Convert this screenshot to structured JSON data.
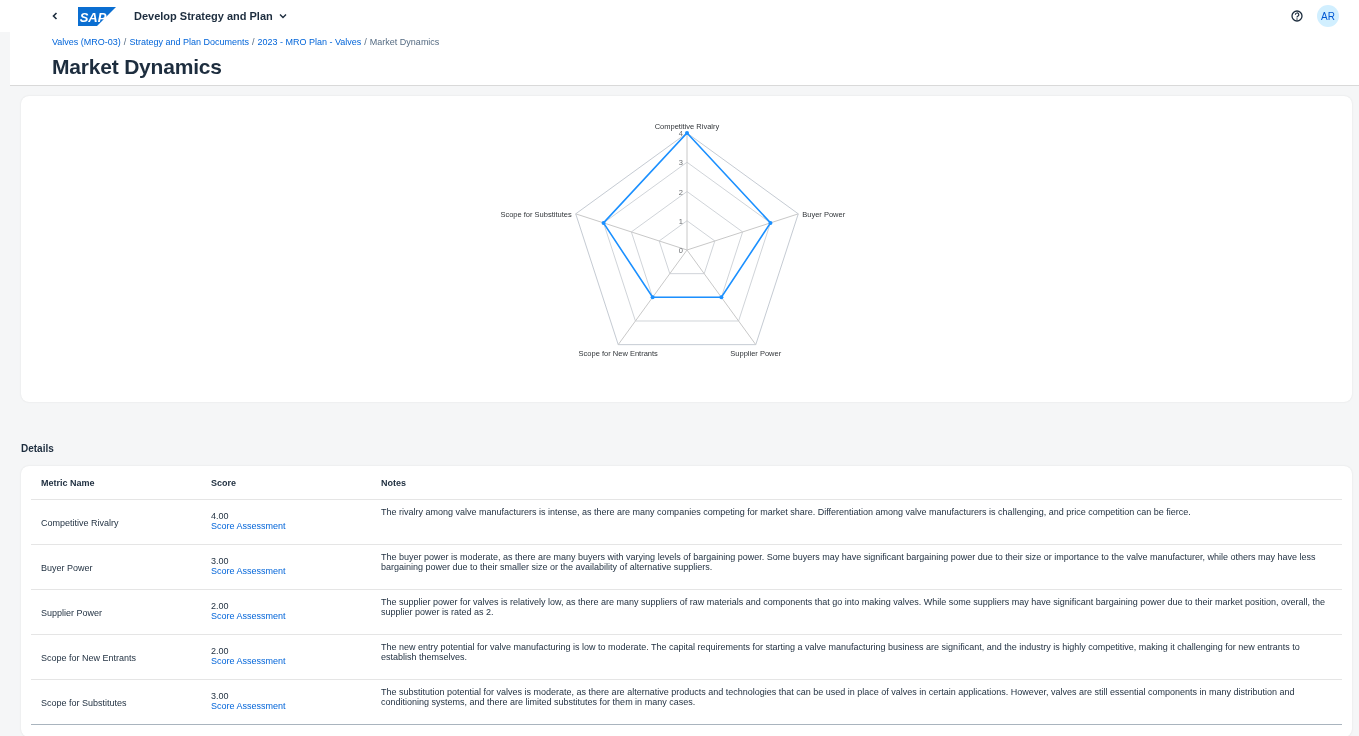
{
  "shell": {
    "logo": "SAP",
    "app_title": "Develop Strategy and Plan",
    "avatar": "AR"
  },
  "breadcrumbs": [
    {
      "label": "Valves (MRO-03)",
      "kind": "link"
    },
    {
      "label": "/",
      "kind": "separator"
    },
    {
      "label": "Strategy and Plan Documents",
      "kind": "link"
    },
    {
      "label": "/",
      "kind": "separator"
    },
    {
      "label": "2023 - MRO Plan - Valves",
      "kind": "link"
    },
    {
      "label": "/",
      "kind": "separator"
    },
    {
      "label": "Market Dynamics",
      "kind": "current"
    }
  ],
  "title": "Market Dynamics",
  "chart": {
    "chart_data": {
      "type": "radar",
      "categories": [
        "Competitive Rivalry",
        "Buyer Power",
        "Supplier Power",
        "Scope for New Entrants",
        "Scope for Substitutes"
      ],
      "values": [
        4,
        3,
        2,
        2,
        3
      ],
      "ylim": [
        0,
        4
      ],
      "yticks": [
        0,
        1,
        2,
        3,
        4
      ]
    }
  },
  "details": {
    "title": "Details",
    "columns": [
      "Metric Name",
      "Score",
      "Notes"
    ],
    "rows": [
      {
        "metric": "Competitive Rivalry",
        "score": "4.00",
        "link": "Score Assessment",
        "notes": "The rivalry among valve manufacturers is intense, as there are many companies competing for market share. Differentiation among valve manufacturers is challenging, and price competition can be fierce."
      },
      {
        "metric": "Buyer Power",
        "score": "3.00",
        "link": "Score Assessment",
        "notes": "The buyer power is moderate, as there are many buyers with varying levels of bargaining power. Some buyers may have significant bargaining power due to their size or importance to the valve manufacturer, while others may have less bargaining power due to their smaller size or the availability of alternative suppliers."
      },
      {
        "metric": "Supplier Power",
        "score": "2.00",
        "link": "Score Assessment",
        "notes": "The supplier power for valves is relatively low, as there are many suppliers of raw materials and components that go into making valves. While some suppliers may have significant bargaining power due to their market position, overall, the supplier power is rated as 2."
      },
      {
        "metric": "Scope for New Entrants",
        "score": "2.00",
        "link": "Score Assessment",
        "notes": "The new entry potential for valve manufacturing is low to moderate. The capital requirements for starting a valve manufacturing business are significant, and the industry is highly competitive, making it challenging for new entrants to establish themselves."
      },
      {
        "metric": "Scope for Substitutes",
        "score": "3.00",
        "link": "Score Assessment",
        "notes": "The substitution potential for valves is moderate, as there are alternative products and technologies that can be used in place of valves in certain applications. However, valves are still essential components in many distribution and conditioning systems, and there are limited substitutes for them in many cases."
      }
    ]
  }
}
